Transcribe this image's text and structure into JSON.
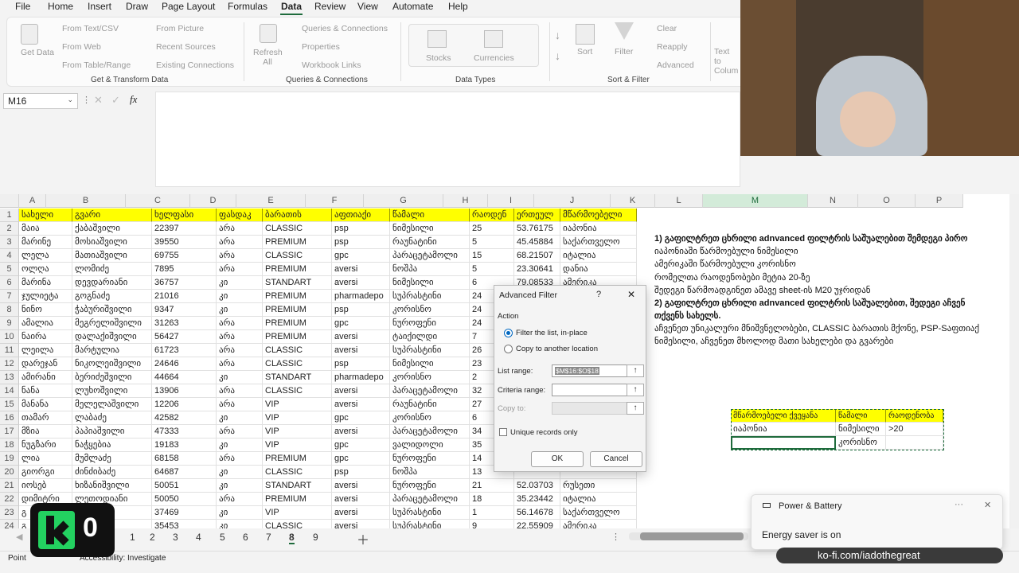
{
  "menu": [
    "File",
    "Home",
    "Insert",
    "Draw",
    "Page Layout",
    "Formulas",
    "Data",
    "Review",
    "View",
    "Automate",
    "Help"
  ],
  "ribbon": {
    "get_data": "Get Data",
    "from_text_csv": "From Text/CSV",
    "from_web": "From Web",
    "from_table_range": "From Table/Range",
    "from_picture": "From Picture",
    "recent_sources": "Recent Sources",
    "existing_connections": "Existing Connections",
    "group_get_transform": "Get & Transform Data",
    "refresh_all": "Refresh All",
    "queries_connections": "Queries & Connections",
    "properties": "Properties",
    "workbook_links": "Workbook Links",
    "group_queries": "Queries & Connections",
    "stocks": "Stocks",
    "currencies": "Currencies",
    "group_data_types": "Data Types",
    "sort": "Sort",
    "filter": "Filter",
    "clear": "Clear",
    "reapply": "Reapply",
    "advanced": "Advanced",
    "group_sort_filter": "Sort & Filter",
    "text_to_columns": "Text to Colum"
  },
  "formula_bar": {
    "name_box": "M16",
    "fx": "fx"
  },
  "columns": [
    "A",
    "B",
    "C",
    "D",
    "E",
    "F",
    "G",
    "H",
    "I",
    "J",
    "K",
    "L",
    "M",
    "N",
    "O",
    "P"
  ],
  "rows": [
    [
      "1",
      "სახელი",
      "გვარი",
      "ხელფასი",
      "ფასდაკ",
      "ბარათის",
      "აფთიაქი",
      "წამალი",
      "რაოდენ",
      "ერთეულ",
      "მწარმოებელი"
    ],
    [
      "2",
      "მაია",
      "ქაბაშვილი",
      "22397",
      "არა",
      "CLASSIC",
      "psp",
      "ნიმესილი",
      "25",
      "53.76175",
      "იაპონია"
    ],
    [
      "3",
      "მარინე",
      "მოსიაშვილი",
      "39550",
      "არა",
      "PREMIUM",
      "psp",
      "რაუნატინი",
      "5",
      "45.45884",
      "საქართველო"
    ],
    [
      "4",
      "ლელა",
      "მათიაშვილი",
      "69755",
      "არა",
      "CLASSIC",
      "gpc",
      "პარაცეტამოლი",
      "15",
      "68.21507",
      "იტალია"
    ],
    [
      "5",
      "ოლღა",
      "ლომიძე",
      "7895",
      "არა",
      "PREMIUM",
      "aversi",
      "ნოშპა",
      "5",
      "23.30641",
      "დანია"
    ],
    [
      "6",
      "მარინა",
      "დევდარიანი",
      "36757",
      "კი",
      "STANDART",
      "aversi",
      "ნიმესილი",
      "6",
      "79.08533",
      "ამერიკა"
    ],
    [
      "7",
      "ჯულიეტა",
      "გოგნაძე",
      "21016",
      "კი",
      "PREMIUM",
      "pharmadepo",
      "სუპრასტინი",
      "24",
      "",
      ""
    ],
    [
      "8",
      "ნინო",
      "ჭაბურიშვილი",
      "9347",
      "კი",
      "PREMIUM",
      "psp",
      "კორისნო",
      "24",
      "",
      ""
    ],
    [
      "9",
      "ამალია",
      "მეგრელიშვილი",
      "31263",
      "არა",
      "PREMIUM",
      "gpc",
      "ნუროფენი",
      "24",
      "",
      ""
    ],
    [
      "10",
      "ნაირა",
      "დალაქიშვილი",
      "56427",
      "არა",
      "PREMIUM",
      "aversi",
      "ტაიქილდი",
      "7",
      "",
      ""
    ],
    [
      "11",
      "ლეილა",
      "მარტულია",
      "61723",
      "არა",
      "CLASSIC",
      "aversi",
      "სუპრასტინი",
      "26",
      "",
      ""
    ],
    [
      "12",
      "დარეჯან",
      "ნიკოლეიშვილი",
      "24646",
      "არა",
      "CLASSIC",
      "psp",
      "ნიმესილი",
      "23",
      "",
      ""
    ],
    [
      "13",
      "ამირანი",
      "ბერიძეშვილი",
      "44664",
      "კი",
      "STANDART",
      "pharmadepo",
      "კორისნო",
      "2",
      "",
      ""
    ],
    [
      "14",
      "ნანა",
      "ლუხოშვილი",
      "13906",
      "არა",
      "CLASSIC",
      "aversi",
      "პარაცეტამოლი",
      "32",
      "",
      ""
    ],
    [
      "15",
      "მანანა",
      "მელელაშვილი",
      "12206",
      "არა",
      "VIP",
      "aversi",
      "რაუნატინი",
      "27",
      "",
      ""
    ],
    [
      "16",
      "თამარ",
      "ლაბაძე",
      "42582",
      "კი",
      "VIP",
      "gpc",
      "კორისნო",
      "6",
      "",
      ""
    ],
    [
      "17",
      "მზია",
      "პაპიაშვილი",
      "47333",
      "არა",
      "VIP",
      "aversi",
      "პარაცეტამოლი",
      "34",
      "",
      ""
    ],
    [
      "18",
      "ნუგზარი",
      "ნაჭყებია",
      "19183",
      "კი",
      "VIP",
      "gpc",
      "ვალიდოლი",
      "35",
      "",
      ""
    ],
    [
      "19",
      "ლია",
      "მუმლაძე",
      "68158",
      "არა",
      "PREMIUM",
      "gpc",
      "ნუროფენი",
      "14",
      "",
      ""
    ],
    [
      "20",
      "გიორგი",
      "ძინძიბაძე",
      "64687",
      "კი",
      "CLASSIC",
      "psp",
      "ნოშპა",
      "13",
      "",
      ""
    ],
    [
      "21",
      "იოსებ",
      "ხიზანიშვილი",
      "50051",
      "კი",
      "STANDART",
      "aversi",
      "ნუროფენი",
      "21",
      "52.03703",
      "რუსეთი"
    ],
    [
      "22",
      "დიმიტრი",
      "ლეთოდიანი",
      "50050",
      "არა",
      "PREMIUM",
      "aversi",
      "პარაცეტამოლი",
      "18",
      "35.23442",
      "იტალია"
    ],
    [
      "23",
      "გ",
      "",
      "37469",
      "კი",
      "VIP",
      "aversi",
      "სუპრასტინი",
      "1",
      "56.14678",
      "საქართველო"
    ],
    [
      "24",
      "გ",
      "",
      "35453",
      "კი",
      "CLASSIC",
      "aversi",
      "სუპრასტინი",
      "9",
      "22.55909",
      "ამერიკა"
    ]
  ],
  "notes": [
    "1) გაფილტრეთ ცხრილი adnvanced ფილტრის საშუალებით შემდეგი პირო",
    "იაპონიაში წარმოებული ნიმესილი",
    "ამერიკაში წარმოებული კორისნო",
    "რომელთა რაოდენობები მეტია 20-ზე",
    "შედეგი წარმოადგინეთ ამავე sheet-ის M20 უჯრიდან",
    "2) გაფილტრეთ ცხრილი adnvanced ფილტრის საშუალებით, შედეგი აჩვენ",
    "თქვენს სახელს.",
    "აჩვენეთ უნიკალური მნიშვნელობები, CLASSIC ბარათის მქონე, PSP-Sაფთიაქ",
    "ნიმესილი, აჩვენეთ მხოლოდ მათი სახელები და გვარები"
  ],
  "criteria": {
    "headers": [
      "მწარმოებელი ქვეყანა",
      "წამალი",
      "რაოდენობა"
    ],
    "row1": [
      "იაპონია",
      "ნიმესილი",
      ">20"
    ],
    "row2": [
      "",
      "კორისნო",
      ""
    ]
  },
  "dialog": {
    "title": "Advanced Filter",
    "help": "?",
    "close": "✕",
    "action": "Action",
    "opt_inplace": "Filter the list, in-place",
    "opt_copy": "Copy to another location",
    "list_range_label": "List range:",
    "list_range_value": "$M$16:$O$18",
    "criteria_range_label": "Criteria range:",
    "copy_to_label": "Copy to:",
    "unique_label": "Unique records only",
    "ok": "OK",
    "cancel": "Cancel"
  },
  "sheet_tabs": [
    "1",
    "2",
    "3",
    "4",
    "5",
    "6",
    "7",
    "8",
    "9"
  ],
  "active_tab": "8",
  "status": {
    "mode": "Point",
    "accessibility": "Accessibility: Investigate"
  },
  "toast": {
    "title": "Power & Battery",
    "message": "Energy saver is on",
    "more": "···",
    "close": "✕"
  },
  "overlay_url": "ko-fi.com/iadothegreat",
  "logo_text": "0",
  "colors": {
    "header_yellow": "#ffff00",
    "excel_green": "#1e6b3c",
    "dialog_bg": "#f4f4f4"
  }
}
